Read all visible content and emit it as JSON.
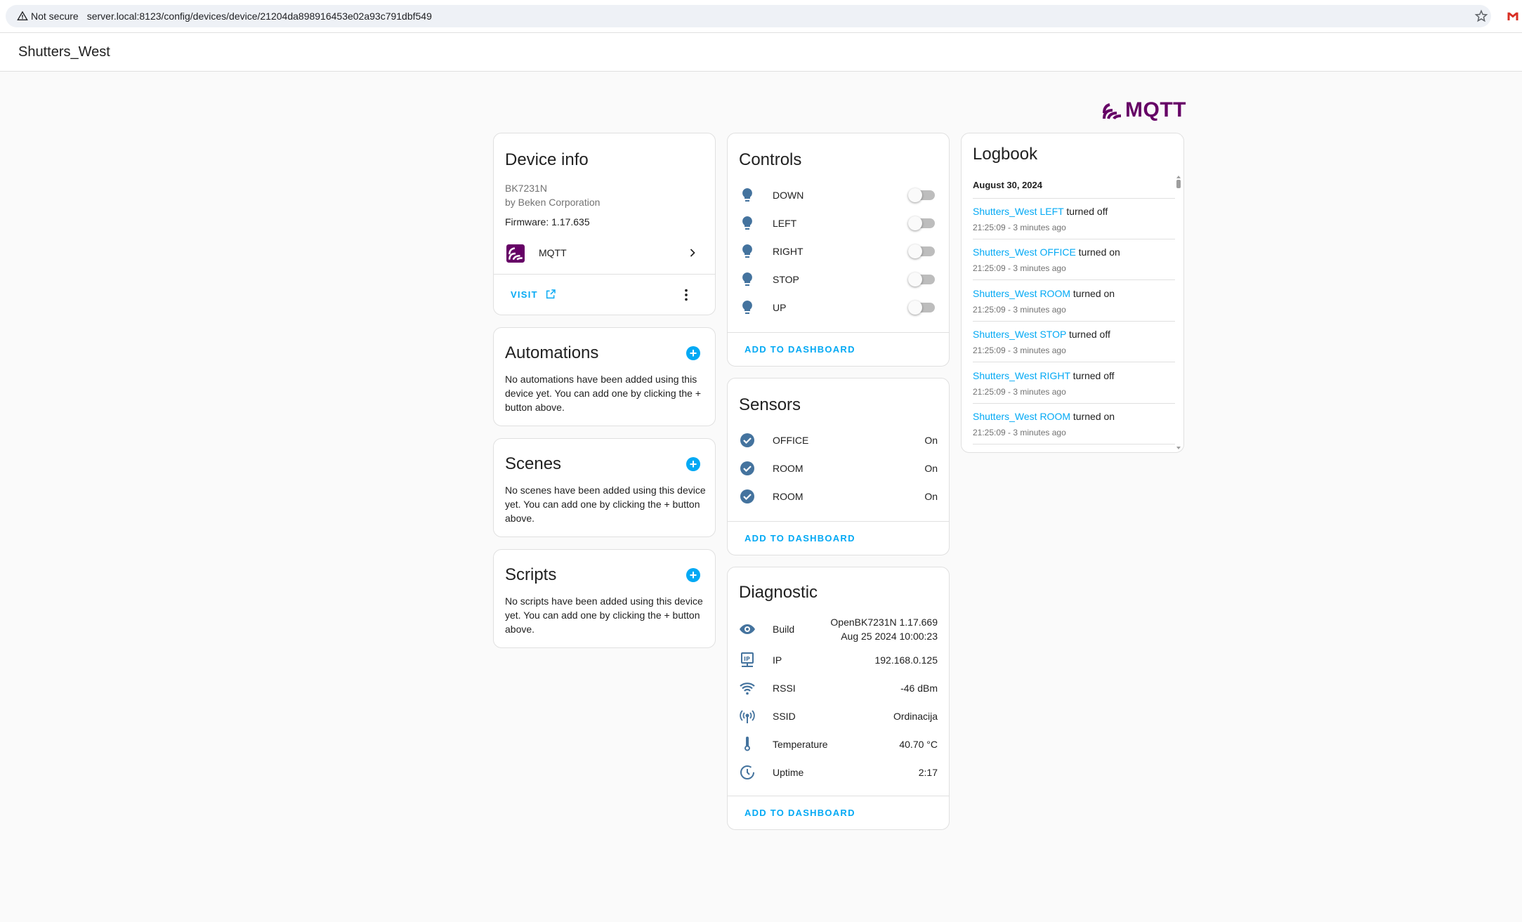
{
  "browser": {
    "security_label": "Not secure",
    "url": "server.local:8123/config/devices/device/21204da898916453e02a93c791dbf549"
  },
  "header": {
    "title": "Shutters_West"
  },
  "integration_logo": {
    "text": "MQTT",
    "color": "#660066"
  },
  "colors": {
    "accent": "#03a9f4",
    "icon": "#44739e",
    "divider": "#e0e0e0"
  },
  "device_info": {
    "title": "Device info",
    "model": "BK7231N",
    "manufacturer": "by Beken Corporation",
    "firmware": "Firmware: 1.17.635",
    "integration": "MQTT",
    "visit_label": "VISIT"
  },
  "automations": {
    "title": "Automations",
    "empty_text": "No automations have been added using this device yet. You can add one by clicking the + button above."
  },
  "scenes": {
    "title": "Scenes",
    "empty_text": "No scenes have been added using this device yet. You can add one by clicking the + button above."
  },
  "scripts": {
    "title": "Scripts",
    "empty_text": "No scripts have been added using this device yet. You can add one by clicking the + button above."
  },
  "controls": {
    "title": "Controls",
    "items": [
      {
        "label": "DOWN",
        "icon": "lightbulb-icon",
        "state": "off"
      },
      {
        "label": "LEFT",
        "icon": "lightbulb-icon",
        "state": "off"
      },
      {
        "label": "RIGHT",
        "icon": "lightbulb-icon",
        "state": "off"
      },
      {
        "label": "STOP",
        "icon": "lightbulb-icon",
        "state": "off"
      },
      {
        "label": "UP",
        "icon": "lightbulb-icon",
        "state": "off"
      }
    ],
    "add_label": "ADD TO DASHBOARD"
  },
  "sensors": {
    "title": "Sensors",
    "items": [
      {
        "label": "OFFICE",
        "value": "On",
        "icon": "check-circle-icon"
      },
      {
        "label": "ROOM",
        "value": "On",
        "icon": "check-circle-icon"
      },
      {
        "label": "ROOM",
        "value": "On",
        "icon": "check-circle-icon"
      }
    ],
    "add_label": "ADD TO DASHBOARD"
  },
  "diagnostic": {
    "title": "Diagnostic",
    "items": [
      {
        "label": "Build",
        "value_line1": "OpenBK7231N 1.17.669",
        "value_line2": "Aug 25 2024 10:00:23",
        "icon": "eye-icon"
      },
      {
        "label": "IP",
        "value": "192.168.0.125",
        "icon": "ip-network-icon"
      },
      {
        "label": "RSSI",
        "value": "-46 dBm",
        "icon": "wifi-icon"
      },
      {
        "label": "SSID",
        "value": "Ordinacija",
        "icon": "access-point-icon"
      },
      {
        "label": "Temperature",
        "value": "40.70 °C",
        "icon": "thermometer-icon"
      },
      {
        "label": "Uptime",
        "value": "2:17",
        "icon": "clock-icon"
      }
    ],
    "add_label": "ADD TO DASHBOARD"
  },
  "logbook": {
    "title": "Logbook",
    "date": "August 30, 2024",
    "entries": [
      {
        "entity": "Shutters_West LEFT",
        "action": "turned off",
        "time": "21:25:09 - 3 minutes ago"
      },
      {
        "entity": "Shutters_West OFFICE",
        "action": "turned on",
        "time": "21:25:09 - 3 minutes ago"
      },
      {
        "entity": "Shutters_West ROOM",
        "action": "turned on",
        "time": "21:25:09 - 3 minutes ago"
      },
      {
        "entity": "Shutters_West STOP",
        "action": "turned off",
        "time": "21:25:09 - 3 minutes ago"
      },
      {
        "entity": "Shutters_West RIGHT",
        "action": "turned off",
        "time": "21:25:09 - 3 minutes ago"
      },
      {
        "entity": "Shutters_West ROOM",
        "action": "turned on",
        "time": "21:25:09 - 3 minutes ago"
      }
    ]
  }
}
